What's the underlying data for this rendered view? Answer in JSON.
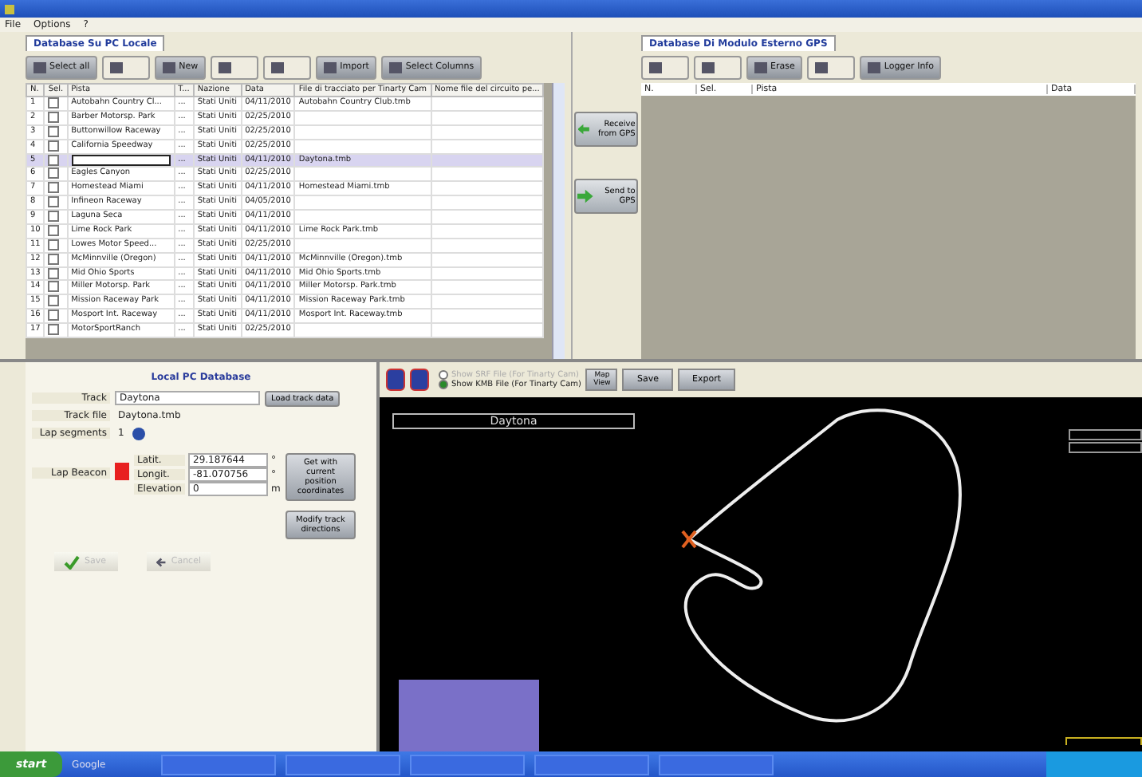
{
  "menu": [
    "File",
    "Options",
    "?"
  ],
  "left_panel": {
    "tab": {
      "label": "Database Su PC Locale",
      "selected": true
    },
    "toolbar": [
      {
        "label": "Select all",
        "disabled": false
      },
      {
        "disabled": true
      },
      {
        "label": "New",
        "disabled": false
      },
      {
        "disabled": true
      },
      {
        "disabled": true
      },
      {
        "label": "Import",
        "disabled": false
      },
      {
        "label": "Select Columns",
        "disabled": false
      }
    ],
    "table": {
      "columns": [
        "N.",
        "Sel.",
        "Pista",
        "T...",
        "Nazione",
        "Data",
        "File di tracciato per Tinarty Cam",
        "Nome file del circuito pe..."
      ],
      "rows": [
        {
          "cells": [
            "1",
            "",
            "Autobahn Country Cl...",
            "...",
            "Stati Uniti",
            "04/11/2010",
            "Autobahn Country Club.tmb",
            ""
          ],
          "checked": false,
          "selected": false
        },
        {
          "cells": [
            "2",
            "",
            "Barber Motorsp. Park",
            "...",
            "Stati Uniti",
            "02/25/2010",
            "",
            ""
          ],
          "checked": false,
          "selected": false
        },
        {
          "cells": [
            "3",
            "",
            "Buttonwillow Raceway",
            "...",
            "Stati Uniti",
            "02/25/2010",
            "",
            ""
          ],
          "checked": false,
          "selected": false
        },
        {
          "cells": [
            "4",
            "",
            "California Speedway",
            "...",
            "Stati Uniti",
            "02/25/2010",
            "",
            ""
          ],
          "checked": false,
          "selected": false
        },
        {
          "cells": [
            "5",
            "",
            "",
            "...",
            "Stati Uniti",
            "04/11/2010",
            "Daytona.tmb",
            ""
          ],
          "checked": false,
          "selected": true
        },
        {
          "cells": [
            "6",
            "",
            "Eagles Canyon",
            "...",
            "Stati Uniti",
            "02/25/2010",
            "",
            ""
          ],
          "checked": false,
          "selected": false
        },
        {
          "cells": [
            "7",
            "",
            "Homestead Miami",
            "...",
            "Stati Uniti",
            "04/11/2010",
            "Homestead Miami.tmb",
            ""
          ],
          "checked": false,
          "selected": false
        },
        {
          "cells": [
            "8",
            "",
            "Infineon Raceway",
            "...",
            "Stati Uniti",
            "04/05/2010",
            "",
            ""
          ],
          "checked": false,
          "selected": false
        },
        {
          "cells": [
            "9",
            "",
            "Laguna Seca",
            "...",
            "Stati Uniti",
            "04/11/2010",
            "",
            ""
          ],
          "checked": false,
          "selected": false
        },
        {
          "cells": [
            "10",
            "",
            "Lime Rock Park",
            "...",
            "Stati Uniti",
            "04/11/2010",
            "Lime Rock Park.tmb",
            ""
          ],
          "checked": false,
          "selected": false
        },
        {
          "cells": [
            "11",
            "",
            "Lowes Motor Speed...",
            "...",
            "Stati Uniti",
            "02/25/2010",
            "",
            ""
          ],
          "checked": false,
          "selected": false
        },
        {
          "cells": [
            "12",
            "",
            "McMinnville (Oregon)",
            "...",
            "Stati Uniti",
            "04/11/2010",
            "McMinnville (Oregon).tmb",
            ""
          ],
          "checked": false,
          "selected": false
        },
        {
          "cells": [
            "13",
            "",
            "Mid Ohio Sports",
            "...",
            "Stati Uniti",
            "04/11/2010",
            "Mid Ohio Sports.tmb",
            ""
          ],
          "checked": false,
          "selected": false
        },
        {
          "cells": [
            "14",
            "",
            "Miller Motorsp. Park",
            "...",
            "Stati Uniti",
            "04/11/2010",
            "Miller Motorsp. Park.tmb",
            ""
          ],
          "checked": false,
          "selected": false
        },
        {
          "cells": [
            "15",
            "",
            "Mission Raceway Park",
            "...",
            "Stati Uniti",
            "04/11/2010",
            "Mission Raceway Park.tmb",
            ""
          ],
          "checked": false,
          "selected": false
        },
        {
          "cells": [
            "16",
            "",
            "Mosport Int. Raceway",
            "...",
            "Stati Uniti",
            "04/11/2010",
            "Mosport Int. Raceway.tmb",
            ""
          ],
          "checked": false,
          "selected": false
        },
        {
          "cells": [
            "17",
            "",
            "MotorSportRanch",
            "...",
            "Stati Uniti",
            "02/25/2010",
            "",
            ""
          ],
          "checked": false,
          "selected": false
        }
      ]
    }
  },
  "transfer_buttons": [
    {
      "label": "Receive from GPS",
      "kind": "receive"
    },
    {
      "label": "Send to GPS",
      "kind": "send"
    }
  ],
  "right_panel": {
    "tab": {
      "label": "Database Di Modulo Esterno GPS",
      "selected": true
    },
    "toolbar": [
      {
        "disabled": true
      },
      {
        "disabled": true
      },
      {
        "label": "Erase",
        "disabled": false
      },
      {
        "disabled": true
      },
      {
        "label": "Logger Info",
        "disabled": false
      }
    ],
    "table": {
      "columns": [
        "N.",
        "Sel.",
        "Pista",
        "Data"
      ]
    }
  },
  "form": {
    "title": "Local PC Database",
    "track": "Daytona",
    "track_file": "Daytona.tmb",
    "lap_segments": "1",
    "labels": {
      "track": "Track",
      "track_file": "Track file",
      "lap_segments": "Lap segments",
      "lap_beacon": "Lap Beacon",
      "lat": "Latit.",
      "lon": "Longit.",
      "elev": "Elevation"
    },
    "lat": "29.187644",
    "lat_unit": "°",
    "lon": "-81.070756",
    "lon_unit": "°",
    "elev": "0",
    "elev_unit": "m",
    "load_button": "Load track data",
    "coords_button": "Get with current position coordinates",
    "modify_button": "Modify track directions",
    "actions": [
      {
        "label": "Save",
        "kind": "ok",
        "disabled": true
      },
      {
        "label": "Cancel",
        "kind": "cancel",
        "disabled": true
      }
    ]
  },
  "map": {
    "options": [
      {
        "label": "Show SRF File (For Tinarty Cam)",
        "selected": false,
        "disabled": true
      },
      {
        "label": "Show KMB File (For Tinarty Cam)",
        "selected": true,
        "disabled": false
      }
    ],
    "buttons": [
      "Map View",
      "Save",
      "Export"
    ],
    "track_name": "Daytona"
  },
  "taskbar": {
    "start": "start",
    "search": "Google"
  }
}
